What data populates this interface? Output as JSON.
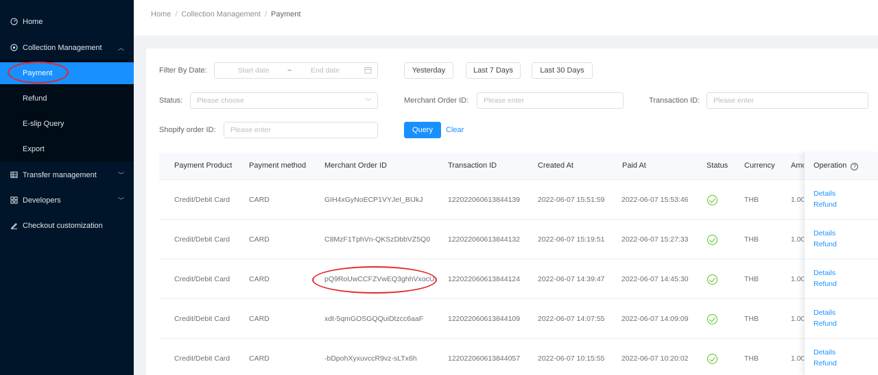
{
  "sidebar": {
    "items": [
      {
        "label": "Home",
        "icon": "dashboard-icon"
      },
      {
        "label": "Collection Management",
        "icon": "collection-icon"
      },
      {
        "label": "Transfer management",
        "icon": "table-icon"
      },
      {
        "label": "Developers",
        "icon": "grid-icon"
      },
      {
        "label": "Checkout customization",
        "icon": "brush-icon"
      }
    ],
    "sub_items": [
      {
        "label": "Payment"
      },
      {
        "label": "Refund"
      },
      {
        "label": "E-slip Query"
      },
      {
        "label": "Export"
      }
    ]
  },
  "breadcrumb": {
    "home": "Home",
    "section": "Collection Management",
    "current": "Payment",
    "sep": "/"
  },
  "filters": {
    "date_label": "Filter By Date:",
    "start_placeholder": "Start date",
    "range_sep": "~",
    "end_placeholder": "End date",
    "yesterday": "Yesterday",
    "last7": "Last 7 Days",
    "last30": "Last 30 Days",
    "status_label": "Status:",
    "status_placeholder": "Please choose",
    "merchant_label": "Merchant Order ID:",
    "merchant_placeholder": "Please enter",
    "transaction_label": "Transaction ID:",
    "transaction_placeholder": "Please enter",
    "shopify_label": "Shopify order ID:",
    "shopify_placeholder": "Please enter",
    "query": "Query",
    "clear": "Clear"
  },
  "table": {
    "headers": {
      "product": "Payment Product",
      "method": "Payment method",
      "merchant": "Merchant Order ID",
      "transaction": "Transaction ID",
      "created": "Created At",
      "paid": "Paid At",
      "status": "Status",
      "currency": "Currency",
      "amount": "Amo",
      "operation": "Operation"
    },
    "rows": [
      {
        "product": "Credit/Debit Card",
        "method": "CARD",
        "merchant": "GIH4xGyNoECP1VYJeI_BIJkJ",
        "transaction": "122022060613844139",
        "created": "2022-06-07 15:51:59",
        "paid": "2022-06-07 15:53:46",
        "currency": "THB",
        "amount": "1.00",
        "details": "Details",
        "refund": "Refund"
      },
      {
        "product": "Credit/Debit Card",
        "method": "CARD",
        "merchant": "C8MzF1TphVn-QKSzDbbVZ5Q0",
        "transaction": "122022060613844132",
        "created": "2022-06-07 15:19:51",
        "paid": "2022-06-07 15:27:33",
        "currency": "THB",
        "amount": "1.00",
        "details": "Details",
        "refund": "Refund"
      },
      {
        "product": "Credit/Debit Card",
        "method": "CARD",
        "merchant": "pQ9RoUwCCFZVwEQ3ghhVxocU",
        "transaction": "122022060613844124",
        "created": "2022-06-07 14:39:47",
        "paid": "2022-06-07 14:45:30",
        "currency": "THB",
        "amount": "1.00",
        "details": "Details",
        "refund": "Refund"
      },
      {
        "product": "Credit/Debit Card",
        "method": "CARD",
        "merchant": "xdt-5qmGOSGQQuiDtzcc6aaF",
        "transaction": "122022060613844109",
        "created": "2022-06-07 14:07:55",
        "paid": "2022-06-07 14:09:09",
        "currency": "THB",
        "amount": "1.00",
        "details": "Details",
        "refund": "Refund"
      },
      {
        "product": "Credit/Debit Card",
        "method": "CARD",
        "merchant": "-bDpohXyxuvccR9vz-sLTx6h",
        "transaction": "122022060613844057",
        "created": "2022-06-07 10:15:55",
        "paid": "2022-06-07 10:20:02",
        "currency": "THB",
        "amount": "1.00",
        "details": "Details",
        "refund": "Refund"
      }
    ]
  },
  "colors": {
    "sidebar": "#001529",
    "accent": "#1890ff",
    "success": "#52c41a",
    "annotation": "#e0282e"
  }
}
